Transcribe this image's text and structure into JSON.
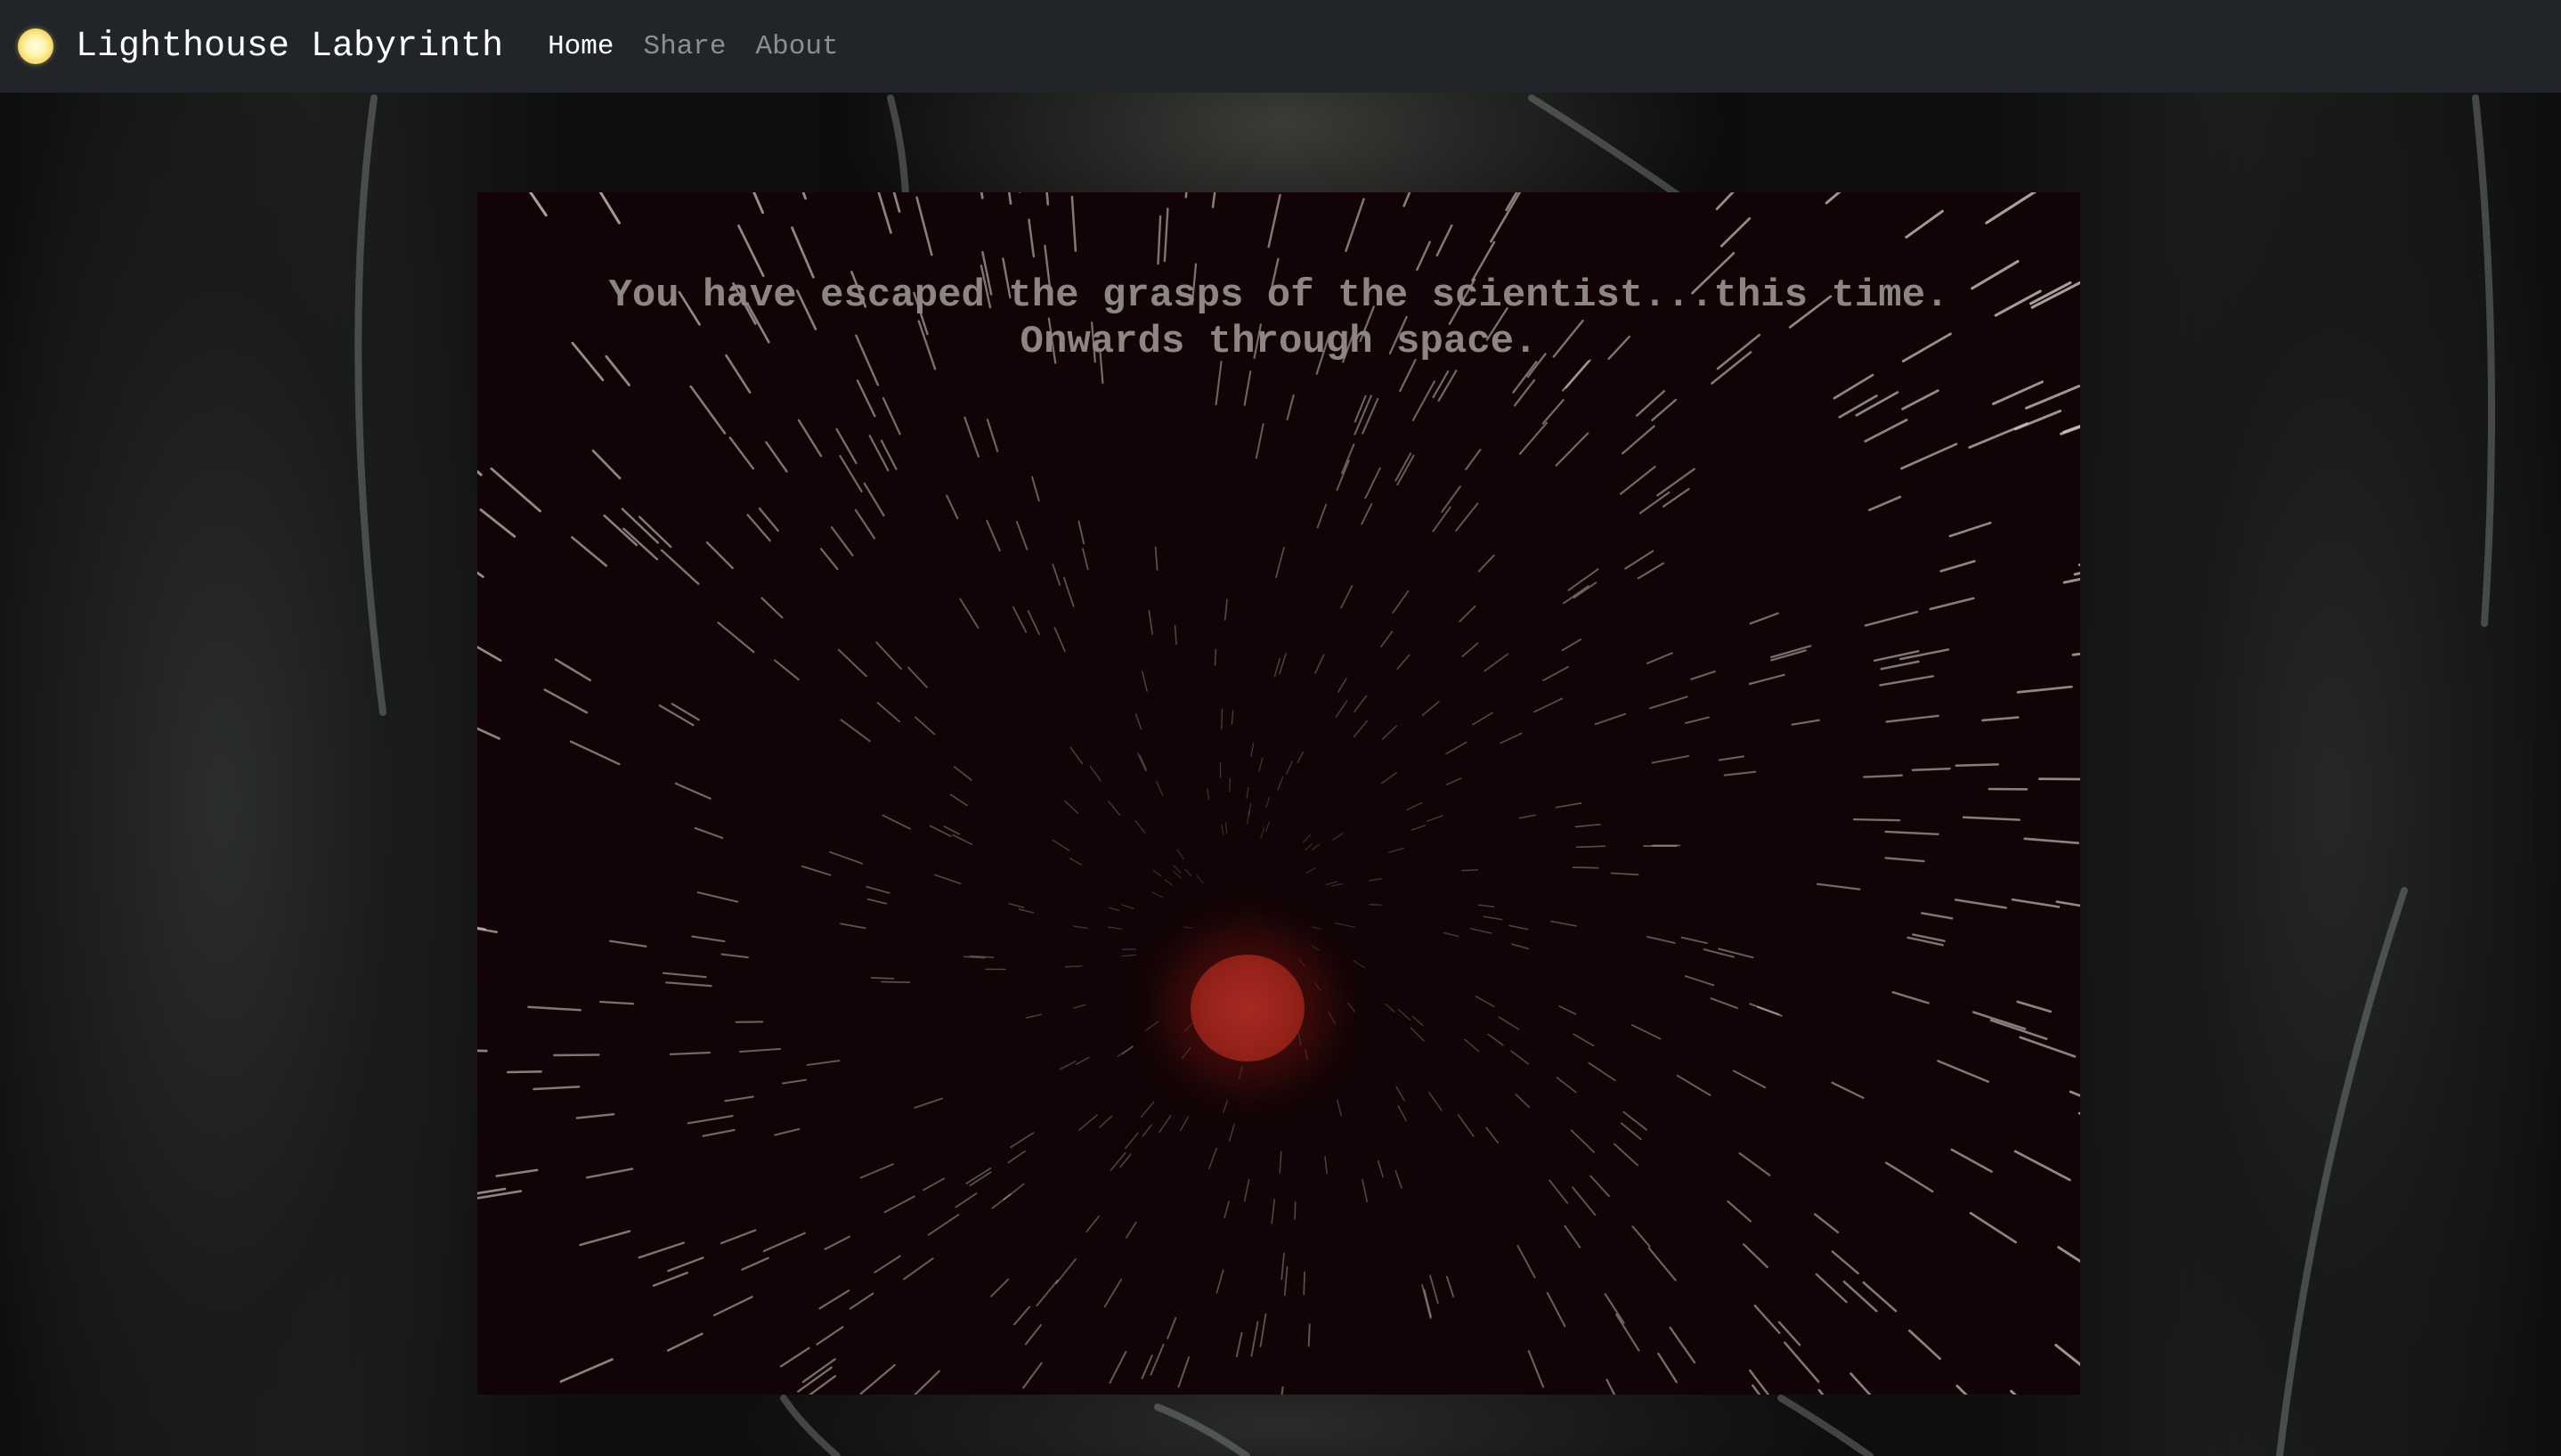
{
  "navbar": {
    "logo_icon": "glowing-light-orb",
    "brand": "Lighthouse Labyrinth",
    "links": [
      {
        "label": "Home",
        "active": true
      },
      {
        "label": "Share",
        "active": false
      },
      {
        "label": "About",
        "active": false
      }
    ]
  },
  "game": {
    "message_lines": [
      "You have escaped the grasps of the scientist...this time.",
      "Onwards through space."
    ],
    "player_icon": "red-orb",
    "background_effect": "warp-starfield"
  },
  "colors": {
    "navbar_bg": "#212529",
    "nav_active": "#ffffff",
    "nav_inactive": "#8c8f92",
    "game_bg": "#120406",
    "message_text": "#8e8585",
    "orb": "#952219"
  }
}
